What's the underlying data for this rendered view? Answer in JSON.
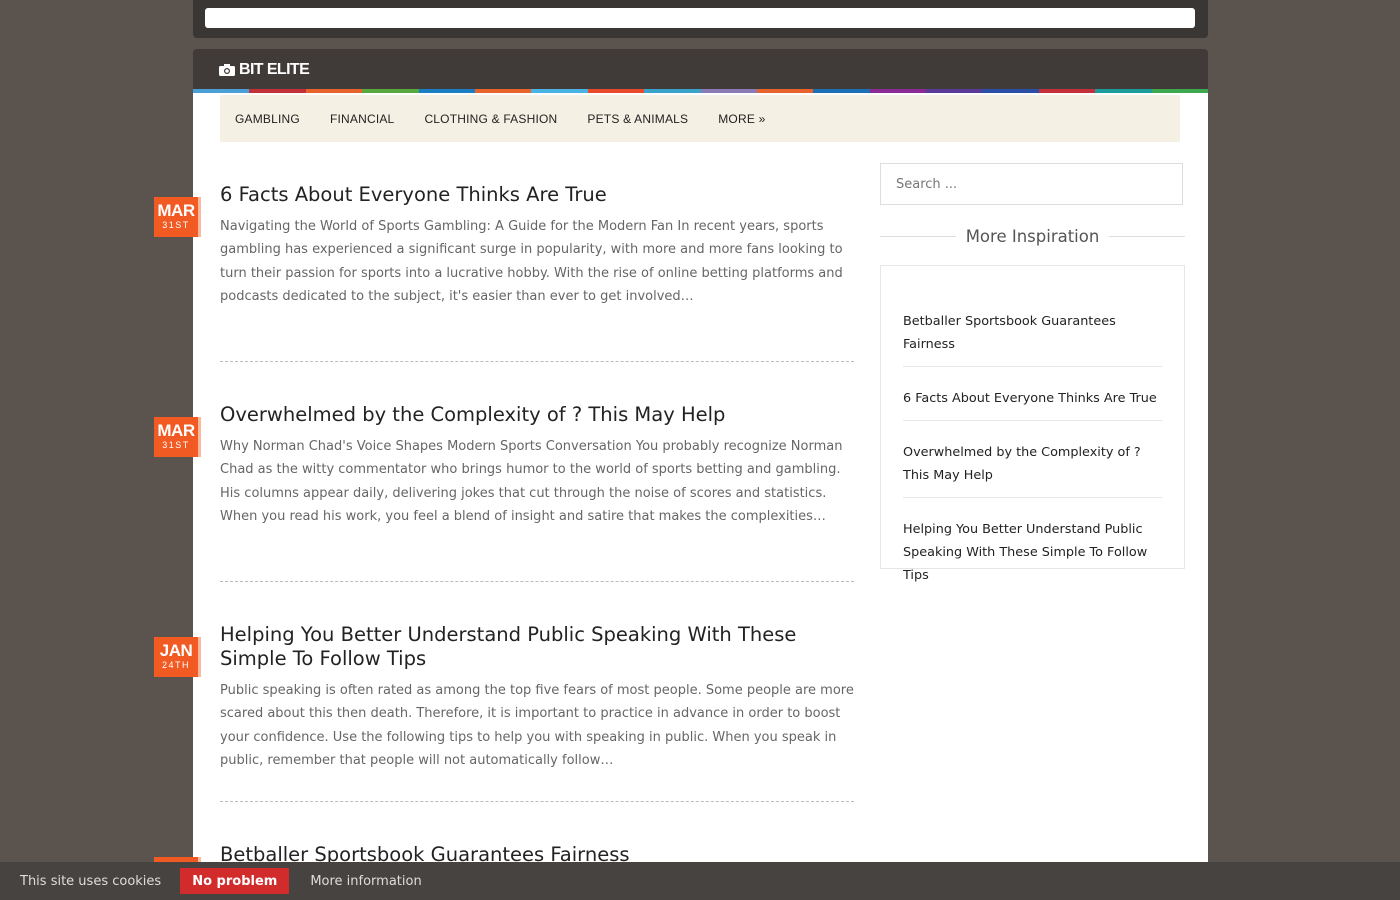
{
  "site": {
    "logo_text": "BIT ELITE"
  },
  "stripe_colors": [
    "#4a9fd6",
    "#c2303a",
    "#e8632b",
    "#56a83f",
    "#1a7ec5",
    "#e8642b",
    "#4ab3e6",
    "#e84a2b",
    "#3aa3c9",
    "#8a7bb5",
    "#e8632b",
    "#1a6fb5",
    "#8a2a94",
    "#5a3a98",
    "#2a4fa8",
    "#c4303a",
    "#1a9d9b",
    "#3ea84f"
  ],
  "nav": {
    "items": [
      "GAMBLING",
      "FINANCIAL",
      "CLOTHING & FASHION",
      "PETS & ANIMALS",
      "MORE »"
    ]
  },
  "posts": [
    {
      "month": "MAR",
      "day": "31ST",
      "title": "6 Facts About Everyone Thinks Are True",
      "excerpt": "Navigating the World of Sports Gambling: A Guide for the Modern Fan In recent years, sports gambling has experienced a significant surge in popularity, with more and more fans looking to turn their passion for sports into a lucrative hobby. With the rise of online betting platforms and podcasts dedicated to the subject, it's easier than ever to get involved…"
    },
    {
      "month": "MAR",
      "day": "31ST",
      "title": "Overwhelmed by the Complexity of ? This May Help",
      "excerpt": "Why Norman Chad's Voice Shapes Modern Sports Conversation You probably recognize Norman Chad as the witty commentator who brings humor to the world of sports betting and gambling. His columns appear daily, delivering jokes that cut through the noise of scores and statistics. When you read his work, you feel a blend of insight and satire that makes the complexities…"
    },
    {
      "month": "JAN",
      "day": "24TH",
      "title": "Helping You Better Understand Public Speaking With These Simple To Follow Tips",
      "excerpt": "Public speaking is often rated as among the top five fears of most people. Some people are more scared about this then death. Therefore, it is important to practice in advance in order to boost your confidence. Use the following tips to help you with speaking in public. When you speak in public, remember that people will not automatically follow…"
    },
    {
      "month": "",
      "day": "",
      "title": "Betballer Sportsbook Guarantees Fairness",
      "excerpt": ""
    }
  ],
  "sidebar": {
    "search_placeholder": "Search ...",
    "widget_title": "More Inspiration",
    "links": [
      "Betballer Sportsbook Guarantees Fairness",
      "6 Facts About Everyone Thinks Are True",
      "Overwhelmed by the Complexity of ? This May Help",
      "Helping You Better Understand Public Speaking With These Simple To Follow Tips"
    ]
  },
  "cookie": {
    "text": "This site uses cookies",
    "button_label": "No problem",
    "more_label": "More information"
  }
}
